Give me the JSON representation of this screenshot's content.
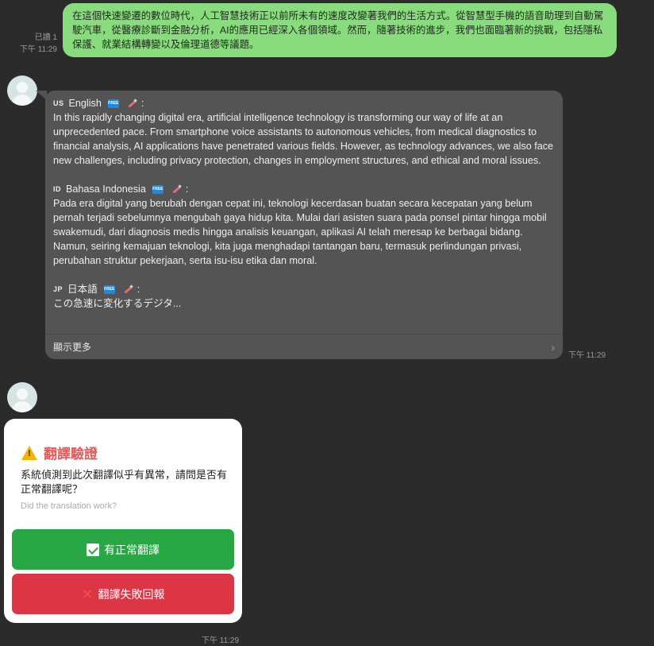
{
  "outgoing": {
    "text": "在這個快速變遷的數位時代，人工智慧技術正以前所未有的速度改變著我們的生活方式。從智慧型手機的語音助理到自動駕駛汽車，從醫療診斷到金融分析，AI的應用已經深入各個領域。然而，隨著技術的進步，我們也面臨著新的挑戰，包括隱私保護、就業結構轉變以及倫理道德等議題。",
    "read_status": "已讀 1",
    "time": "下午 11:29"
  },
  "translation": {
    "free_badge": "FREE",
    "sections": [
      {
        "flag": "US",
        "language": "English",
        "text": "In this rapidly changing digital era, artificial intelligence technology is transforming our way of life at an unprecedented pace. From smartphone voice assistants to autonomous vehicles, from medical diagnostics to financial analysis, AI applications have penetrated various fields. However, as technology advances, we also face new challenges, including privacy protection, changes in employment structures, and ethical and moral issues."
      },
      {
        "flag": "ID",
        "language": "Bahasa Indonesia",
        "text": "Pada era digital yang berubah dengan cepat ini, teknologi kecerdasan buatan secara kecepatan yang belum pernah terjadi sebelumnya mengubah gaya hidup kita. Mulai dari asisten suara pada ponsel pintar hingga mobil swakemudi, dari diagnosis medis hingga analisis keuangan, aplikasi AI telah meresap ke berbagai bidang. Namun, seiring kemajuan teknologi, kita juga menghadapi tantangan baru, termasuk perlindungan privasi, perubahan struktur pekerjaan, serta isu-isu etika dan moral."
      },
      {
        "flag": "JP",
        "language": "日本語",
        "text": "この急速に変化するデジタ..."
      }
    ],
    "show_more": "顯示更多",
    "time": "下午 11:29"
  },
  "verify_card": {
    "title": "翻譯驗證",
    "description": "系統偵測到此次翻譯似乎有異常，請問是否有正常翻譯呢？",
    "subtitle": "Did the translation work?",
    "ok_label": "有正常翻譯",
    "fail_label": "翻譯失敗回報",
    "time": "下午 11:29"
  }
}
